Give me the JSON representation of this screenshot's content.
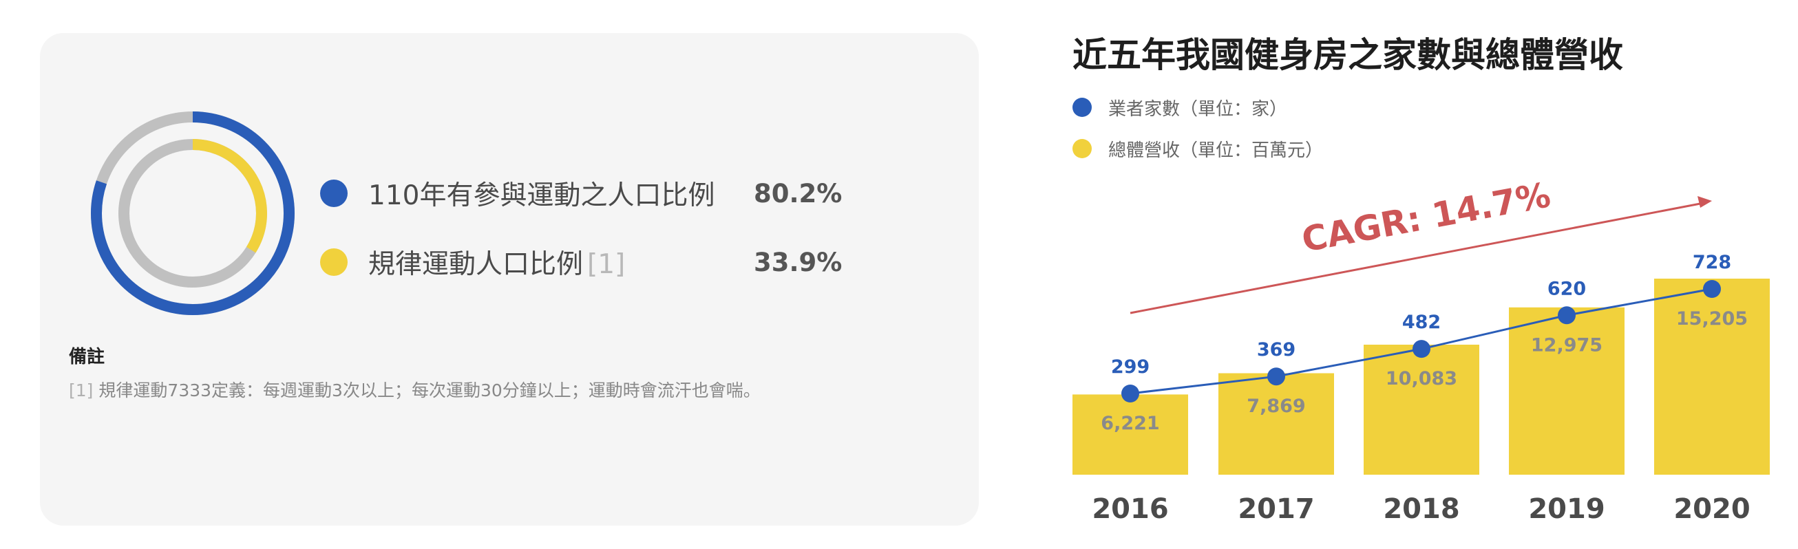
{
  "colors": {
    "blue": "#2a5db8",
    "yellow": "#f1d13c",
    "gray": "#c0c0c0",
    "red": "#cd5657"
  },
  "left_panel": {
    "legend": [
      {
        "label": "110年有參與運動之人口比例",
        "ref": "",
        "value": "80.2%",
        "percent": 80.2,
        "color": "#2a5db8"
      },
      {
        "label": "規律運動人口比例",
        "ref": "[1]",
        "value": "33.9%",
        "percent": 33.9,
        "color": "#f1d13c"
      }
    ],
    "note_title": "備註",
    "note_ref": "[1]",
    "note_text": "規律運動7333定義：每週運動3次以上；每次運動30分鐘以上；運動時會流汗也會喘。"
  },
  "chart_data": {
    "type": "bar",
    "title": "近五年我國健身房之家數與總體營收",
    "categories": [
      "2016",
      "2017",
      "2018",
      "2019",
      "2020"
    ],
    "series": [
      {
        "name": "業者家數（單位：家）",
        "type": "line",
        "color": "#2a5db8",
        "values": [
          299,
          369,
          482,
          620,
          728
        ],
        "labels": [
          "299",
          "369",
          "482",
          "620",
          "728"
        ]
      },
      {
        "name": "總體營收（單位：百萬元）",
        "type": "bar",
        "color": "#f1d13c",
        "values": [
          6221,
          7869,
          10083,
          12975,
          15205
        ],
        "labels": [
          "6,221",
          "7,869",
          "10,083",
          "12,975",
          "15,205"
        ]
      }
    ],
    "annotation": "CAGR: 14.7%",
    "legend_position": "top-left",
    "grid": false
  }
}
